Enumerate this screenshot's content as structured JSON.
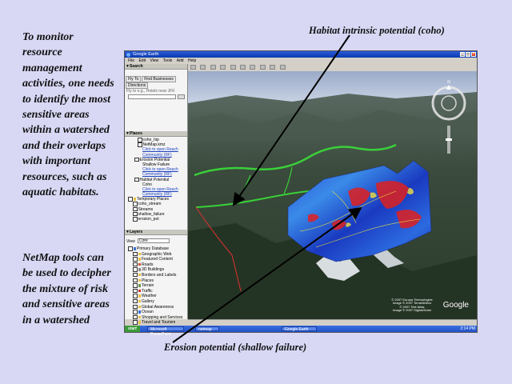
{
  "slide": {
    "para1": "To monitor resource management activities, one needs to identify the most sensitive areas within a watershed and their overlaps with important resources, such as aquatic habitats.",
    "para2": "NetMap tools can be used to decipher the mixture of risk and sensitive areas in a watershed",
    "callout_top": "Habitat intrinsic potential (coho)",
    "callout_bottom": "Erosion potential (shallow failure)"
  },
  "app": {
    "window_title": "Google Earth",
    "menu": [
      "File",
      "Edit",
      "View",
      "Tools",
      "Add",
      "Help"
    ],
    "search_panel": {
      "title": "Search",
      "tabs": [
        "Fly To",
        "Find Businesses",
        "Directions"
      ],
      "fly_to_label": "Fly to e.g., Hotels near JFK"
    },
    "places_panel": {
      "title": "Places",
      "items": [
        {
          "label": "coho_hip",
          "type": "plain"
        },
        {
          "label": "NetMap.kmz",
          "type": "plain"
        },
        {
          "label": "Click to open Reach",
          "type": "link"
        },
        {
          "label": "Community (RF)",
          "type": "link"
        },
        {
          "label": "Erosion Potential",
          "type": "plain"
        },
        {
          "label": "Shallow Failure",
          "type": "plain"
        },
        {
          "label": "Click to open Reach",
          "type": "link"
        },
        {
          "label": "Community (RF)",
          "type": "link"
        },
        {
          "label": "Habitat Potential",
          "type": "plain"
        },
        {
          "label": "Coho",
          "type": "plain"
        },
        {
          "label": "Click to open Reach",
          "type": "link"
        },
        {
          "label": "Community (RF)",
          "type": "link"
        },
        {
          "label": "Temporary Places",
          "type": "plain"
        },
        {
          "label": "coho_stream",
          "type": "plain"
        },
        {
          "label": "Streams",
          "type": "plain"
        },
        {
          "label": "shallow_failure",
          "type": "plain"
        },
        {
          "label": "erosion_pot",
          "type": "plain"
        }
      ]
    },
    "layers_panel": {
      "title": "Layers",
      "view_label": "View",
      "view_value": "Core",
      "items": [
        "Primary Database",
        "Geographic Web",
        "Featured Content",
        "Roads",
        "3D Buildings",
        "Borders and Labels",
        "Places",
        "Terrain",
        "Traffic",
        "Weather",
        "Gallery",
        "Global Awareness",
        "Ocean",
        "Shopping and Services",
        "Travel and Tourism"
      ]
    },
    "viewport": {
      "credits": [
        "© 2007 Europa Technologies",
        "Image © 2007 TerraMetrics",
        "© 2007 Tele Atlas",
        "Image © 2007 DigitalGlobe"
      ],
      "logo": "Google",
      "compass_north": "N"
    },
    "taskbar": {
      "start_label": "start",
      "tasks": [
        "Microsoft PowerPoint",
        "netmap",
        "Google Earth"
      ],
      "clock": "2:14 PM"
    }
  }
}
